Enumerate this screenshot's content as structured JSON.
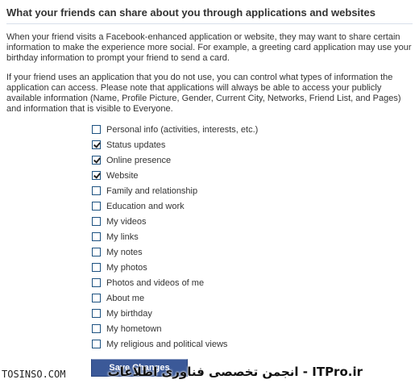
{
  "section": {
    "title": "What your friends can share about you through applications and websites",
    "paragraph1": "When your friend visits a Facebook-enhanced application or website, they may want to share certain information to make the experience more social. For example, a greeting card application may use your birthday information to prompt your friend to send a card.",
    "paragraph2": "If your friend uses an application that you do not use, you can control what types of information the application can access. Please note that applications will always be able to access your publicly available information (Name, Profile Picture, Gender, Current City, Networks, Friend List, and Pages) and information that is visible to Everyone."
  },
  "options": [
    {
      "label": "Personal info (activities, interests, etc.)",
      "checked": false
    },
    {
      "label": "Status updates",
      "checked": true
    },
    {
      "label": "Online presence",
      "checked": true
    },
    {
      "label": "Website",
      "checked": true
    },
    {
      "label": "Family and relationship",
      "checked": false
    },
    {
      "label": "Education and work",
      "checked": false
    },
    {
      "label": "My videos",
      "checked": false
    },
    {
      "label": "My links",
      "checked": false
    },
    {
      "label": "My notes",
      "checked": false
    },
    {
      "label": "My photos",
      "checked": false
    },
    {
      "label": "Photos and videos of me",
      "checked": false
    },
    {
      "label": "About me",
      "checked": false
    },
    {
      "label": "My birthday",
      "checked": false
    },
    {
      "label": "My hometown",
      "checked": false
    },
    {
      "label": "My religious and political views",
      "checked": false
    }
  ],
  "save_button": {
    "label": "Save Changes"
  },
  "watermarks": {
    "left": "TOSINSO.COM",
    "right": "ITPro.ir - انجمن تخصصی فناوری اطلاعات"
  },
  "colors": {
    "button_bg": "#3b5998",
    "checkbox_border": "#1c5180",
    "divider": "#d8dfea",
    "text": "#333333"
  }
}
